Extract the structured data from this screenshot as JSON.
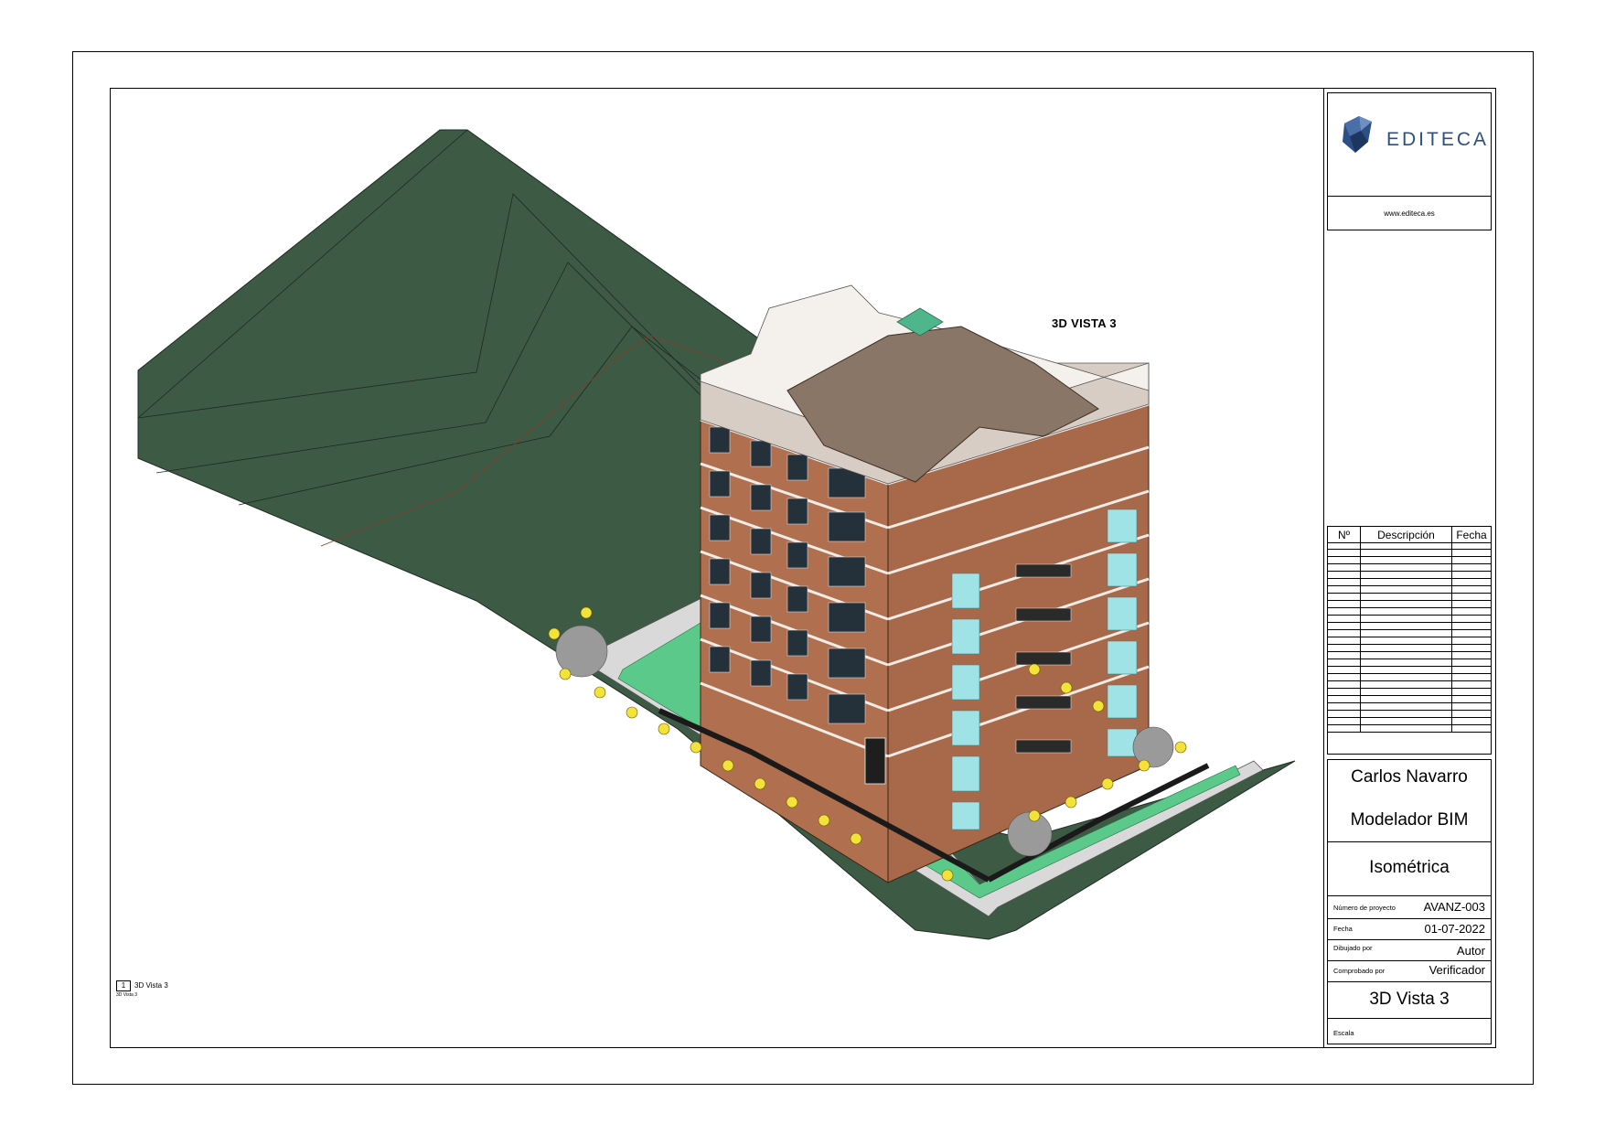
{
  "view": {
    "title": "3D VISTA 3"
  },
  "legend": {
    "number": "1",
    "name": "3D Vista 3",
    "subname": "3D Vista 3"
  },
  "title_block": {
    "company": "EDITECA",
    "website": "www.editeca.es",
    "revisions": {
      "headers": [
        "Nº",
        "Descripción",
        "Fecha"
      ],
      "row_count": 26
    },
    "author_name": "Carlos Navarro",
    "author_role": "Modelador BIM",
    "sheet_name": "Isométrica",
    "project_number_label": "Número de proyecto",
    "project_number": "AVANZ-003",
    "date_label": "Fecha",
    "date": "01-07-2022",
    "drawn_by_label": "Dibujado por",
    "drawn_by": "Autor",
    "checked_by_label": "Comprobado por",
    "checked_by": "Verificador",
    "sheet_title": "3D Vista 3",
    "scale_label": "Escala"
  },
  "colors": {
    "terrain": "#3d5a45",
    "brick": "#b0704f",
    "roof": "#8a7666",
    "glass": "#9fe3e6",
    "slab": "#d8cdc4",
    "sidewalk": "#d9d9d9",
    "grass": "#5bc98a",
    "logo": "#2c4f86"
  }
}
